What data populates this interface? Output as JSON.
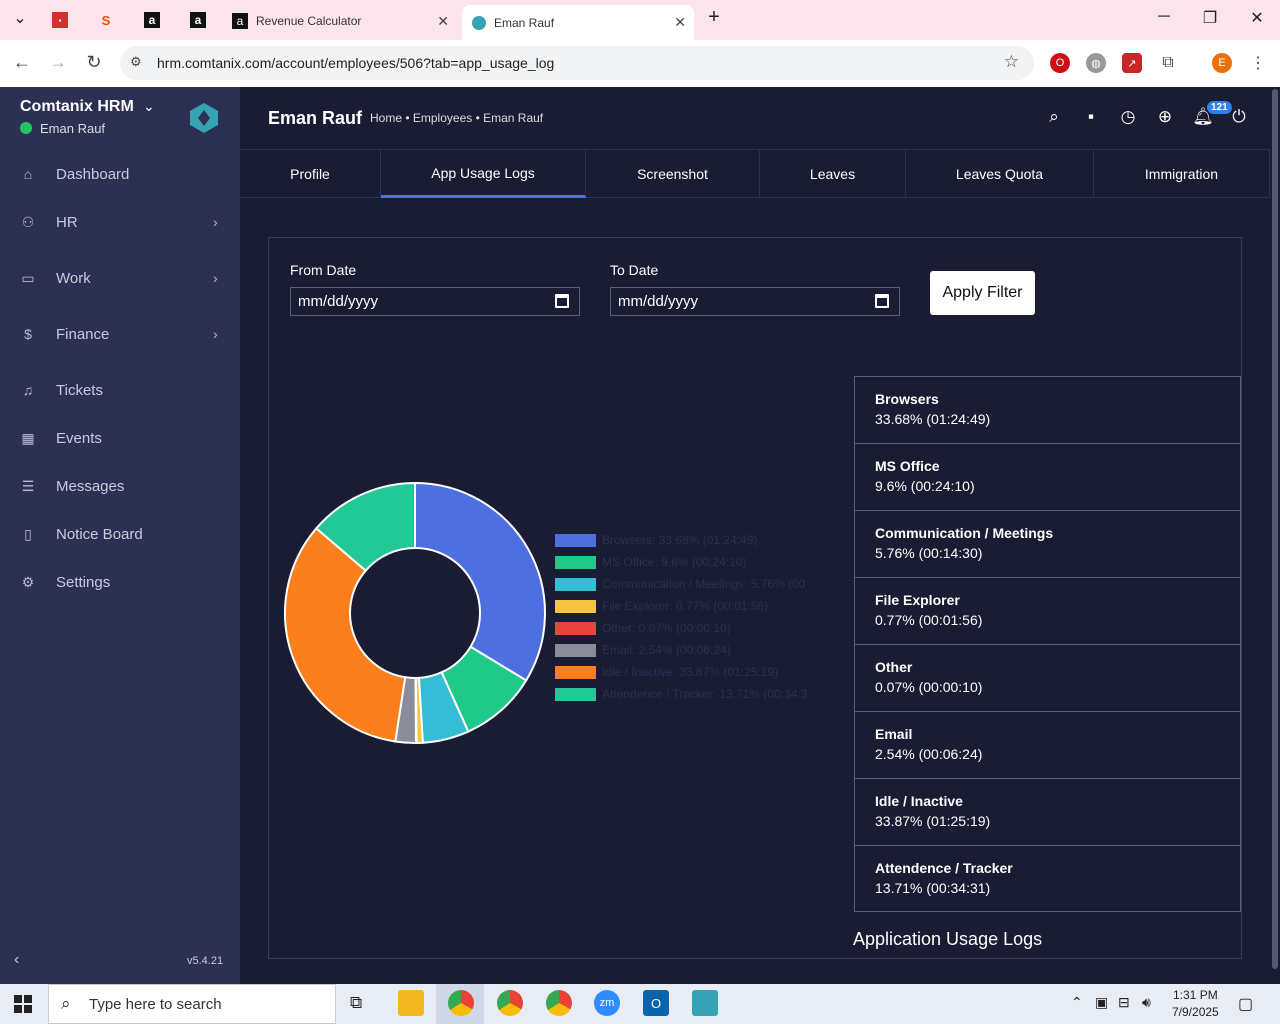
{
  "browser": {
    "tabs": [
      {
        "label": "Revenue Calculator"
      },
      {
        "label": "Eman Rauf"
      }
    ],
    "url": "hrm.comtanix.com/account/employees/506?tab=app_usage_log",
    "profile_initial": "E"
  },
  "sidebar": {
    "brand": "Comtanix HRM",
    "user": "Eman Rauf",
    "items": [
      {
        "label": "Dashboard",
        "icon": "home-icon"
      },
      {
        "label": "HR",
        "icon": "users-icon"
      },
      {
        "label": "Work",
        "icon": "briefcase-icon"
      },
      {
        "label": "Finance",
        "icon": "dollar-icon"
      },
      {
        "label": "Tickets",
        "icon": "headset-icon"
      },
      {
        "label": "Events",
        "icon": "calendar-icon"
      },
      {
        "label": "Messages",
        "icon": "message-icon"
      },
      {
        "label": "Notice Board",
        "icon": "clipboard-icon"
      },
      {
        "label": "Settings",
        "icon": "gear-icon"
      }
    ],
    "version": "v5.4.21"
  },
  "header": {
    "title": "Eman Rauf",
    "breadcrumb": "Home • Employees • Eman Rauf",
    "notifications": "121"
  },
  "page_tabs": [
    "Profile",
    "App Usage Logs",
    "Screenshot",
    "Leaves",
    "Leaves Quota",
    "Immigration"
  ],
  "filter": {
    "from_label": "From Date",
    "to_label": "To Date",
    "date_placeholder": "mm/dd/yyyy",
    "apply_label": "Apply Filter"
  },
  "chart_data": {
    "type": "pie",
    "categories": [
      "Browsers",
      "MS Office",
      "Communication / Meetings",
      "File Explorer",
      "Other",
      "Email",
      "Idle / Inactive",
      "Attendence / Tracker"
    ],
    "values": [
      33.68,
      9.6,
      5.76,
      0.77,
      0.07,
      2.54,
      33.87,
      13.71
    ],
    "colors": [
      "#4e6fe0",
      "#1fc98a",
      "#36bdd6",
      "#f5c542",
      "#e8463c",
      "#8a8c9a",
      "#fb7f1c",
      "#22c997"
    ],
    "legend": [
      "Browsers: 33.68% (01:24:49)",
      "MS Office: 9.6% (00:24:10)",
      "Communication / Meetings: 5.76% (00",
      "File Explorer: 0.77% (00:01:56)",
      "Other: 0.07% (00:00:10)",
      "Email: 2.54% (00:06:24)",
      "Idle / Inactive: 33.87% (01:25:19)",
      "Attendence / Tracker: 13.71% (00:34:3"
    ]
  },
  "stats": [
    {
      "name": "Browsers",
      "value": "33.68% (01:24:49)"
    },
    {
      "name": "MS Office",
      "value": "9.6% (00:24:10)"
    },
    {
      "name": "Communication / Meetings",
      "value": "5.76% (00:14:30)"
    },
    {
      "name": "File Explorer",
      "value": "0.77% (00:01:56)"
    },
    {
      "name": "Other",
      "value": "0.07% (00:00:10)"
    },
    {
      "name": "Email",
      "value": "2.54% (00:06:24)"
    },
    {
      "name": "Idle / Inactive",
      "value": "33.87% (01:25:19)"
    },
    {
      "name": "Attendence / Tracker",
      "value": "13.71% (00:34:31)"
    }
  ],
  "section_title": "Application Usage Logs",
  "taskbar": {
    "search_placeholder": "Type here to search",
    "time": "1:31 PM",
    "date": "7/9/2025"
  }
}
